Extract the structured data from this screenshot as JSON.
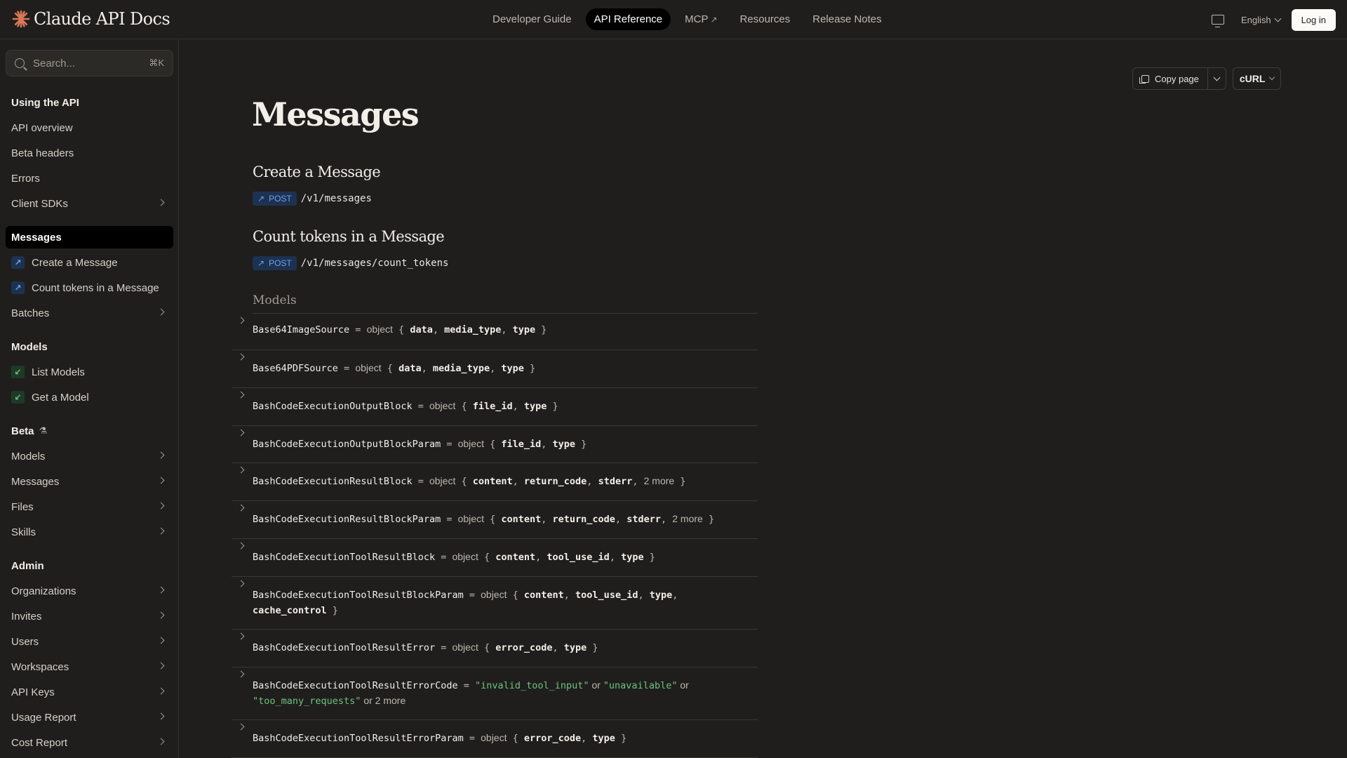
{
  "topnav": {
    "logo_text": "Claude API Docs",
    "links": [
      {
        "label": "Developer Guide",
        "active": false,
        "external": false
      },
      {
        "label": "API Reference",
        "active": true,
        "external": false
      },
      {
        "label": "MCP",
        "active": false,
        "external": true
      },
      {
        "label": "Resources",
        "active": false,
        "external": false
      },
      {
        "label": "Release Notes",
        "active": false,
        "external": false
      }
    ],
    "language": "English",
    "login_label": "Log in"
  },
  "search": {
    "placeholder": "Search...",
    "shortcut": "⌘K"
  },
  "sidebar": {
    "items": [
      {
        "label": "Using the API",
        "kind": "section"
      },
      {
        "label": "API overview",
        "kind": "link"
      },
      {
        "label": "Beta headers",
        "kind": "link"
      },
      {
        "label": "Errors",
        "kind": "link"
      },
      {
        "label": "Client SDKs",
        "kind": "group"
      },
      {
        "label": "Messages",
        "kind": "active"
      },
      {
        "label": "Create a Message",
        "kind": "post"
      },
      {
        "label": "Count tokens in a Message",
        "kind": "post"
      },
      {
        "label": "Batches",
        "kind": "group"
      },
      {
        "label": "Models",
        "kind": "section"
      },
      {
        "label": "List Models",
        "kind": "get"
      },
      {
        "label": "Get a Model",
        "kind": "get"
      },
      {
        "label": "Beta",
        "kind": "beta"
      },
      {
        "label": "Models",
        "kind": "group"
      },
      {
        "label": "Messages",
        "kind": "group"
      },
      {
        "label": "Files",
        "kind": "group"
      },
      {
        "label": "Skills",
        "kind": "group"
      },
      {
        "label": "Admin",
        "kind": "section"
      },
      {
        "label": "Organizations",
        "kind": "group"
      },
      {
        "label": "Invites",
        "kind": "group"
      },
      {
        "label": "Users",
        "kind": "group"
      },
      {
        "label": "Workspaces",
        "kind": "group"
      },
      {
        "label": "API Keys",
        "kind": "group"
      },
      {
        "label": "Usage Report",
        "kind": "group"
      },
      {
        "label": "Cost Report",
        "kind": "group"
      }
    ]
  },
  "toolbar": {
    "copy_label": "Copy page",
    "lang_select": "cURL"
  },
  "page": {
    "title": "Messages",
    "endpoints": [
      {
        "title": "Create a Message",
        "method": "POST",
        "path": "/v1/messages"
      },
      {
        "title": "Count tokens in a Message",
        "method": "POST",
        "path": "/v1/messages/count_tokens"
      }
    ],
    "models_heading": "Models",
    "models": [
      {
        "name": "Base64ImageSource",
        "kind": "object",
        "fields": [
          "data",
          "media_type",
          "type"
        ],
        "more": ""
      },
      {
        "name": "Base64PDFSource",
        "kind": "object",
        "fields": [
          "data",
          "media_type",
          "type"
        ],
        "more": ""
      },
      {
        "name": "BashCodeExecutionOutputBlock",
        "kind": "object",
        "fields": [
          "file_id",
          "type"
        ],
        "more": ""
      },
      {
        "name": "BashCodeExecutionOutputBlockParam",
        "kind": "object",
        "fields": [
          "file_id",
          "type"
        ],
        "more": ""
      },
      {
        "name": "BashCodeExecutionResultBlock",
        "kind": "object",
        "fields": [
          "content",
          "return_code",
          "stderr"
        ],
        "more": "2 more"
      },
      {
        "name": "BashCodeExecutionResultBlockParam",
        "kind": "object",
        "fields": [
          "content",
          "return_code",
          "stderr"
        ],
        "more": "2 more"
      },
      {
        "name": "BashCodeExecutionToolResultBlock",
        "kind": "object",
        "fields": [
          "content",
          "tool_use_id",
          "type"
        ],
        "more": ""
      },
      {
        "name": "BashCodeExecutionToolResultBlockParam",
        "kind": "object",
        "fields": [
          "content",
          "tool_use_id",
          "type",
          "cache_control"
        ],
        "more": ""
      },
      {
        "name": "BashCodeExecutionToolResultError",
        "kind": "object",
        "fields": [
          "error_code",
          "type"
        ],
        "more": ""
      },
      {
        "name": "BashCodeExecutionToolResultErrorCode",
        "kind": "enum",
        "values": [
          "\"invalid_tool_input\"",
          "\"unavailable\"",
          "\"too_many_requests\""
        ],
        "more": "2 more"
      },
      {
        "name": "BashCodeExecutionToolResultErrorParam",
        "kind": "object",
        "fields": [
          "error_code",
          "type"
        ],
        "more": ""
      }
    ]
  },
  "colors": {
    "accent_logo": "#d97757",
    "post_badge": "#6aa2ef",
    "get_badge": "#6fc27c",
    "string_literal": "#6fc27c"
  }
}
